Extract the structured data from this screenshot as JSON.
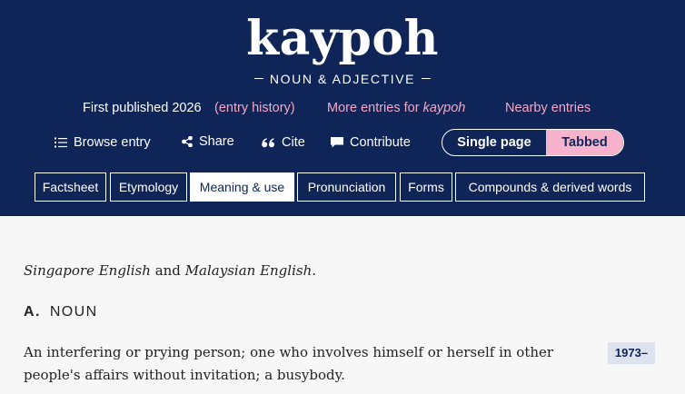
{
  "entry": {
    "headword": "kaypoh",
    "part_of_speech": "NOUN & ADJECTIVE"
  },
  "meta": {
    "published": "First published 2026",
    "history_link": "(entry history)",
    "more_entries_prefix": "More entries for",
    "more_entries_word": "kaypoh",
    "nearby": "Nearby entries"
  },
  "actions": {
    "browse": "Browse entry",
    "share": "Share",
    "cite": "Cite",
    "contribute": "Contribute"
  },
  "view_toggle": {
    "options": [
      "Single page",
      "Tabbed"
    ],
    "selected": "Tabbed"
  },
  "tabs": [
    {
      "label": "Factsheet"
    },
    {
      "label": "Etymology"
    },
    {
      "label": "Meaning & use",
      "active": true
    },
    {
      "label": "Pronunciation"
    },
    {
      "label": "Forms"
    },
    {
      "label": "Compounds & derived words"
    }
  ],
  "content": {
    "region_a": "Singapore English",
    "region_joiner": "and",
    "region_b": "Malaysian English",
    "region_end": ".",
    "section_letter": "A.",
    "section_name": "NOUN",
    "definition": "An interfering or prying person; one who involves himself or herself in other people's affairs without invitation; a busybody.",
    "date": "1973–"
  },
  "colors": {
    "header_bg": "#0f2457",
    "link_pink": "#f6a8c6",
    "toggle_active": "#f6b3cb",
    "date_badge": "#dde3ee"
  },
  "icons": [
    "list-icon",
    "share-icon",
    "quote-icon",
    "speech-bubble-icon"
  ]
}
